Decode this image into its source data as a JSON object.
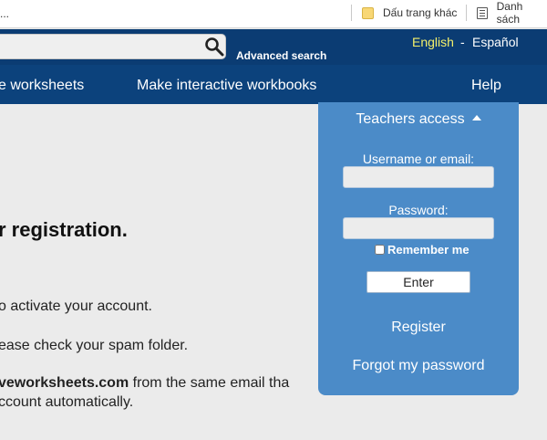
{
  "browser": {
    "bookmarks_left": "...",
    "bookmarks": [
      {
        "label": "Dấu trang khác",
        "icon": "folder-icon"
      },
      {
        "label": "Danh sách",
        "icon": "reading-list-icon"
      }
    ]
  },
  "header": {
    "search_placeholder": "",
    "advanced_search": "Advanced search",
    "languages": {
      "english": "English",
      "separator": "-",
      "spanish": "Español"
    }
  },
  "nav": {
    "items": [
      "e worksheets",
      "Make interactive workbooks",
      "Help"
    ]
  },
  "main": {
    "heading": "r registration.",
    "lines": [
      "o activate your account.",
      "ease check your spam folder.",
      "ccount automatically."
    ],
    "line_with_bold": {
      "bold": "veworksheets.com",
      "rest": " from the same email tha"
    }
  },
  "login": {
    "title": "Teachers access",
    "username_label": "Username or email:",
    "password_label": "Password:",
    "remember_label": "Remember me",
    "enter_label": "Enter",
    "register_link": "Register",
    "forgot_link": "Forgot my password"
  },
  "colors": {
    "header_bg": "#0b3c73",
    "nav_bg": "#0c427c",
    "panel_bg": "#4b8bc8",
    "active_lang": "#f4f06a",
    "page_bg": "#ebebeb"
  }
}
